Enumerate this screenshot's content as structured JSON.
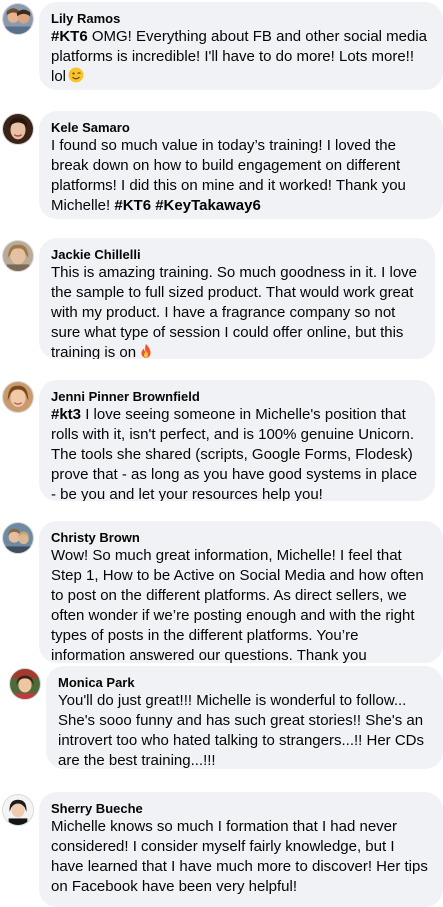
{
  "comments": [
    {
      "author": "Lily Ramos",
      "tag": "#KT6",
      "text": " OMG! Everything about FB and other social media platforms is incredible! I'll have to do more! Lots more!! lol",
      "emoji": "winking-face-emoji"
    },
    {
      "author": "Kele Samaro",
      "text": "I found so much value in today’s training! I loved the break down on how to build engagement on different platforms! I did this on mine and it worked! Thank you Michelle! ",
      "tags": "#KT6 #KeyTakaway6"
    },
    {
      "author": "Jackie Chillelli",
      "text": "This is amazing training. So much goodness in it. I love the sample to full sized product. That would work great with my product. I have a fragrance company so not sure what type of session I could offer online, but this training is on",
      "emoji": "fire-emoji"
    },
    {
      "author": "Jenni Pinner Brownfield",
      "tag": "#kt3",
      "text": " I love seeing someone in Michelle's position that rolls with it, isn't perfect, and is 100% genuine Unicorn. The tools she shared (scripts, Google Forms, Flodesk) prove that - as long as you have good systems in place - be you and let your resources help you!"
    },
    {
      "author": "Christy Brown",
      "text": "Wow! So much great information, Michelle! I feel that Step 1, How to be Active on Social Media and how often to post on the different platforms. As direct sellers, we often wonder if we’re posting enough and with the right types of posts in the different platforms. You’re information answered our questions. Thank you"
    },
    {
      "author": "Monica Park",
      "text": "You'll do just great!!! Michelle is wonderful to follow... She's sooo funny and has such great stories!! She's an introvert too who hated talking to strangers...!! Her CDs are the best training...!!!"
    },
    {
      "author": "Sherry Bueche",
      "text": "Michelle knows so much I formation that I had never considered! I consider myself fairly knowledge, but I have learned that I have much more to discover! Her tips on Facebook have been very helpful!"
    }
  ],
  "colors": {
    "bubble": "#f0f2f5",
    "text": "#050505",
    "page": "#ffffff"
  }
}
